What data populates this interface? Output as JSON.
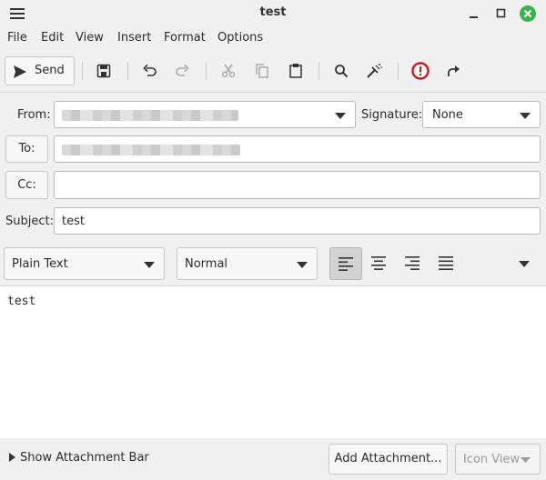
{
  "window": {
    "title": "test",
    "menu_icon": "hamburger-menu-icon",
    "minimize_icon": "minimize-icon",
    "maximize_icon": "maximize-icon",
    "close_icon": "close-icon",
    "close_color": "#3bb34a"
  },
  "menubar": [
    "File",
    "Edit",
    "View",
    "Insert",
    "Format",
    "Options"
  ],
  "toolbar": {
    "send_label": "Send",
    "icons": [
      "save-icon",
      "undo-icon",
      "redo-icon",
      "cut-icon",
      "copy-icon",
      "paste-icon",
      "find-icon",
      "spellcheck-icon",
      "priority-icon",
      "forward-icon"
    ],
    "priority_color": "#d01818"
  },
  "header": {
    "from_label": "From:",
    "signature_label": "Signature:",
    "signature_value": "None",
    "to_label": "To:",
    "cc_label": "Cc:",
    "cc_value": "",
    "subject_label": "Subject:",
    "subject_value": "test"
  },
  "format": {
    "mode": "Plain Text",
    "paragraph": "Normal",
    "alignments": [
      "align-left-icon",
      "align-center-icon",
      "align-right-icon",
      "align-justify-icon"
    ],
    "active_alignment": "align-left-icon"
  },
  "body": {
    "text": "test"
  },
  "attachments": {
    "expander_label": "Show Attachment Bar",
    "add_label": "Add Attachment...",
    "view_label": "Icon View"
  }
}
